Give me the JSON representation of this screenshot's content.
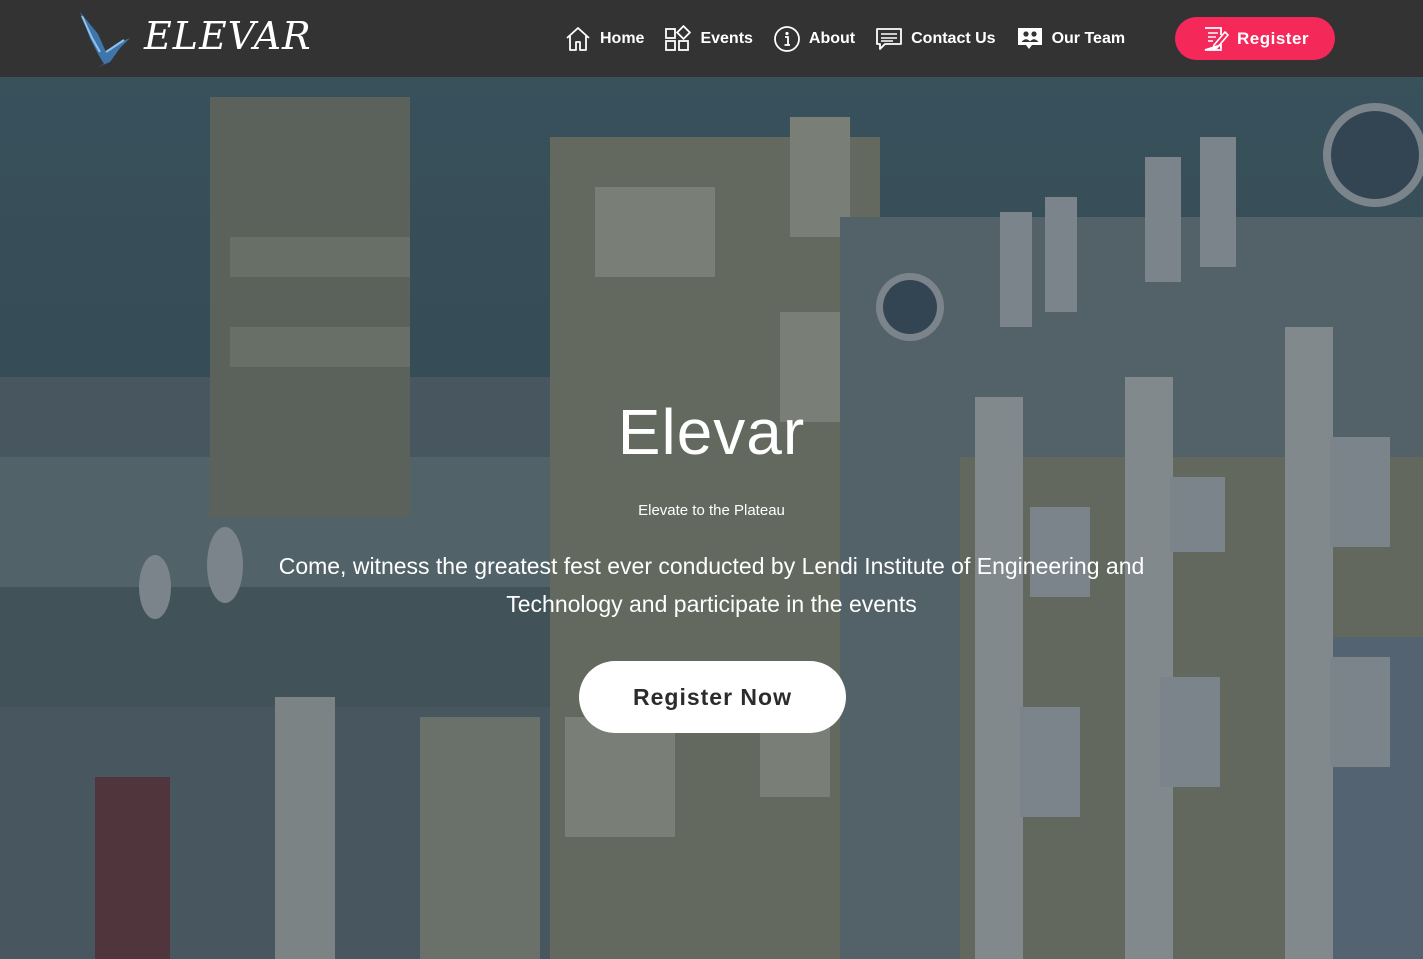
{
  "brand": {
    "name": "ELEVAR",
    "logo_icon": "bird-logo-icon"
  },
  "nav": {
    "items": [
      {
        "label": "Home",
        "icon": "home-icon"
      },
      {
        "label": "Events",
        "icon": "events-grid-icon"
      },
      {
        "label": "About",
        "icon": "info-icon"
      },
      {
        "label": "Contact Us",
        "icon": "chat-icon"
      },
      {
        "label": "Our Team",
        "icon": "team-icon"
      }
    ],
    "register": {
      "label": "Register",
      "icon": "register-form-icon"
    }
  },
  "hero": {
    "title": "Elevar",
    "subtitle": "Elevate to the Plateau",
    "description": "Come, witness the greatest fest ever conducted by Lendi Institute of Engineering and Technology and participate in the events",
    "cta_label": "Register Now"
  },
  "colors": {
    "navbar_bg": "#333333",
    "accent": "#f5285a",
    "text_light": "#ffffff",
    "cta_bg": "#ffffff"
  }
}
